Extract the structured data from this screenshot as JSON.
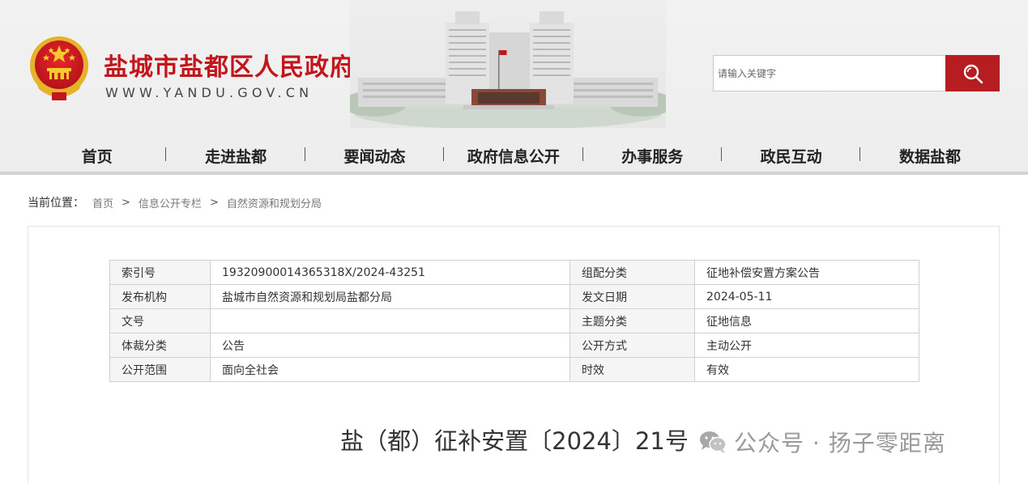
{
  "header": {
    "site_title": "盐城市盐都区人民政府",
    "site_domain": "WWW.YANDU.GOV.CN",
    "search": {
      "placeholder": "请输入关键字"
    },
    "colors": {
      "brand_red": "#c3161c",
      "search_button": "#b51d20"
    }
  },
  "nav": {
    "items": [
      {
        "label": "首页"
      },
      {
        "label": "走进盐都"
      },
      {
        "label": "要闻动态"
      },
      {
        "label": "政府信息公开"
      },
      {
        "label": "办事服务"
      },
      {
        "label": "政民互动"
      },
      {
        "label": "数据盐都"
      }
    ]
  },
  "breadcrumb": {
    "label": "当前位置：",
    "items": [
      "首页",
      "信息公开专栏",
      "自然资源和规划分局"
    ],
    "separator": ">"
  },
  "meta": {
    "rows": [
      {
        "k1": "索引号",
        "v1": "19320900014365318X/2024-43251",
        "k2": "组配分类",
        "v2": "征地补偿安置方案公告"
      },
      {
        "k1": "发布机构",
        "v1": "盐城市自然资源和规划局盐都分局",
        "k2": "发文日期",
        "v2": "2024-05-11"
      },
      {
        "k1": "文号",
        "v1": "",
        "k2": "主题分类",
        "v2": "征地信息"
      },
      {
        "k1": "体裁分类",
        "v1": "公告",
        "k2": "公开方式",
        "v2": "主动公开"
      },
      {
        "k1": "公开范围",
        "v1": "面向全社会",
        "k2": "时效",
        "v2": "有效"
      }
    ]
  },
  "document": {
    "title": "盐（都）征补安置〔2024〕21号"
  },
  "watermark": {
    "text": "公众号 · 扬子零距离",
    "icon": "wechat-icon"
  }
}
